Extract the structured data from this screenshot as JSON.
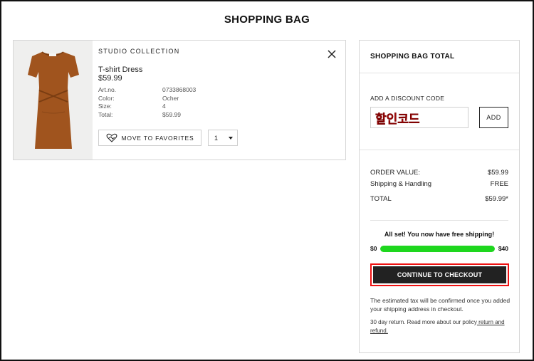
{
  "page": {
    "title": "SHOPPING BAG"
  },
  "product": {
    "brand": "STUDIO COLLECTION",
    "name": "T-shirt Dress",
    "price": "$59.99",
    "attributes": [
      {
        "key": "Art.no.",
        "value": "0733868003"
      },
      {
        "key": "Color:",
        "value": "Ocher"
      },
      {
        "key": "Size:",
        "value": "4"
      },
      {
        "key": "Total:",
        "value": "$59.99"
      }
    ],
    "favorites_label": "MOVE TO FAVORITES",
    "quantity": "1",
    "image_color": "#a0541e"
  },
  "summary": {
    "title": "SHOPPING BAG TOTAL",
    "discount_label": "ADD A DISCOUNT CODE",
    "discount_value": "할인코드",
    "add_label": "ADD",
    "order_value_label": "ORDER VALUE:",
    "order_value": "$59.99",
    "shipping_label": "Shipping & Handling",
    "shipping_value": "FREE",
    "total_label": "TOTAL",
    "total_value": "$59.99*",
    "free_shipping_msg": "All set! You now have free shipping!",
    "bar_min": "$0",
    "bar_max": "$40",
    "bar_progress": 1.0,
    "checkout_label": "CONTINUE TO CHECKOUT",
    "tax_note": "The estimated tax will be confirmed once you added your shipping address in checkout.",
    "return_prefix": "30 day return. Read more about our policy",
    "return_link": " return and refund."
  },
  "colors": {
    "progress": "#1ed71e",
    "checkout_bg": "#222222",
    "highlight": "#ee1111"
  }
}
